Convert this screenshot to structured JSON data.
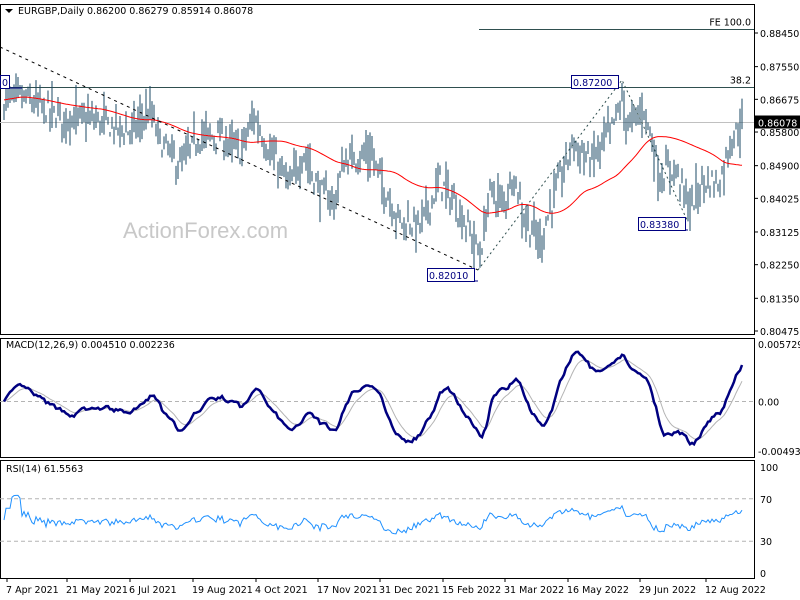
{
  "header": {
    "symbol": "EURGBP,Daily",
    "ohlc": "0.86200 0.86279 0.85914 0.86078"
  },
  "watermark": "ActionForex.com",
  "colors": {
    "bars": "#1b4a66",
    "ma": "#ff0000",
    "macd": "#000080",
    "signal": "#b4b4b4",
    "rsi": "#1e90ff",
    "level": "#2f4f4f"
  },
  "chart_data": [
    {
      "type": "bar",
      "title": "EURGBP,Daily",
      "ylim": [
        0.80475,
        0.8845
      ],
      "yticks": [
        "0.88450",
        "0.87550",
        "0.86675",
        "0.85800",
        "0.84900",
        "0.84025",
        "0.83125",
        "0.82250",
        "0.81350",
        "0.80475"
      ],
      "xticks": [
        "7 Apr 2021",
        "21 May 2021",
        "6 Jul 2021",
        "19 Aug 2021",
        "4 Oct 2021",
        "17 Nov 2021",
        "31 Dec 2021",
        "15 Feb 2022",
        "31 Mar 2022",
        "16 May 2022",
        "29 Jun 2022",
        "12 Aug 2022"
      ],
      "last_price": "0.86078",
      "price_path": {
        "bar_index": [
          0,
          8,
          18,
          28,
          48,
          63,
          73,
          78,
          88,
          98,
          108,
          118,
          125,
          133,
          143,
          150,
          158,
          165,
          170,
          183,
          190,
          198,
          208,
          218,
          225,
          233,
          238,
          243,
          250,
          255,
          260,
          268,
          275,
          285,
          293,
          303,
          309,
          313,
          320,
          328,
          335,
          343,
          350,
          358,
          363,
          369
        ],
        "price": [
          0.8666,
          0.868,
          0.8652,
          0.8626,
          0.8612,
          0.8585,
          0.864,
          0.8559,
          0.8492,
          0.8572,
          0.8572,
          0.8532,
          0.8626,
          0.8532,
          0.8438,
          0.8532,
          0.8425,
          0.8398,
          0.8505,
          0.8532,
          0.8438,
          0.8345,
          0.8335,
          0.8452,
          0.8398,
          0.8318,
          0.8251,
          0.8425,
          0.839,
          0.8478,
          0.8358,
          0.8291,
          0.8412,
          0.8559,
          0.8505,
          0.8585,
          0.8666,
          0.8599,
          0.8652,
          0.8465,
          0.8492,
          0.8385,
          0.8452,
          0.8452,
          0.8559,
          0.8612
        ]
      },
      "annotations": [
        {
          "text": "0.87200"
        },
        {
          "text": "0.83380"
        },
        {
          "text": "0.82010"
        },
        {
          "text": "0"
        },
        {
          "text": "38.2",
          "level": 0.87
        },
        {
          "text": "FE 100.0",
          "level": 0.8855
        }
      ],
      "moving_average": {
        "period": 50
      }
    },
    {
      "type": "line",
      "title": "MACD(12,26,9) 0.004510 0.002236",
      "ylim": [
        -0.00493,
        0.005729
      ],
      "yticks": [
        "0.005729",
        "0.00",
        "-0.00493"
      ],
      "series": [
        {
          "name": "MACD",
          "value": 0.00451
        },
        {
          "name": "Signal",
          "value": 0.002236
        }
      ]
    },
    {
      "type": "line",
      "title": "RSI(14) 61.5563",
      "ylim": [
        0,
        100
      ],
      "yticks": [
        "100",
        "70",
        "30",
        "0"
      ],
      "levels": [
        70,
        30
      ],
      "series": [
        {
          "name": "RSI",
          "value": 61.5563
        }
      ]
    }
  ]
}
